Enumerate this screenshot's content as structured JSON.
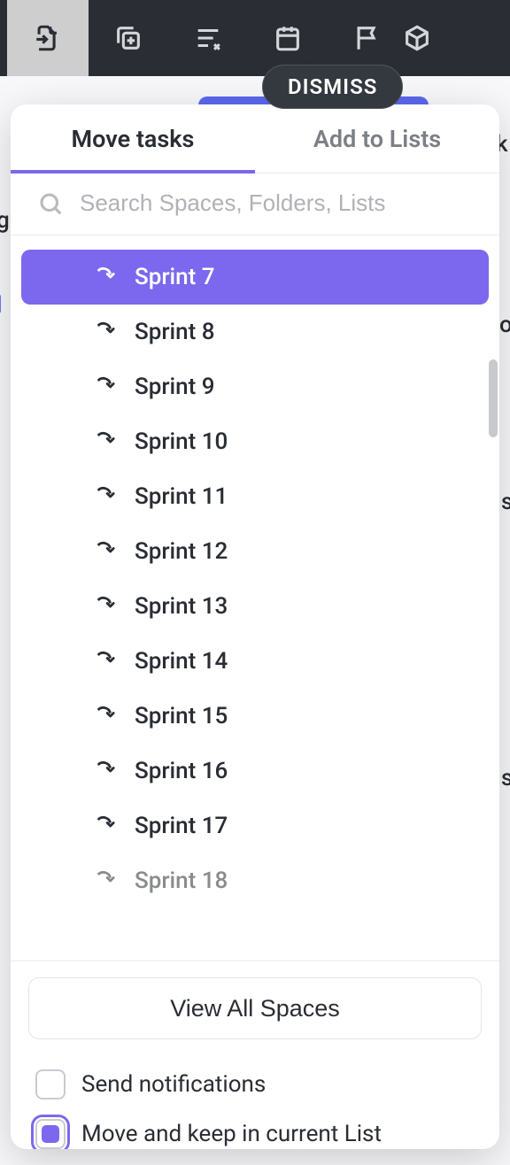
{
  "toolbar": {
    "dismiss_label": "DISMISS"
  },
  "modal": {
    "tabs": {
      "move": "Move tasks",
      "add": "Add to Lists"
    },
    "search_placeholder": "Search Spaces, Folders, Lists",
    "items": [
      {
        "label": "Sprint 7",
        "selected": true
      },
      {
        "label": "Sprint 8",
        "selected": false
      },
      {
        "label": "Sprint 9",
        "selected": false
      },
      {
        "label": "Sprint 10",
        "selected": false
      },
      {
        "label": "Sprint 11",
        "selected": false
      },
      {
        "label": "Sprint 12",
        "selected": false
      },
      {
        "label": "Sprint 13",
        "selected": false
      },
      {
        "label": "Sprint 14",
        "selected": false
      },
      {
        "label": "Sprint 15",
        "selected": false
      },
      {
        "label": "Sprint 16",
        "selected": false
      },
      {
        "label": "Sprint 17",
        "selected": false
      },
      {
        "label": "Sprint 18",
        "selected": false
      }
    ],
    "view_all_label": "View All Spaces",
    "checkbox_notify": "Send notifications",
    "checkbox_keep": "Move and keep in current List",
    "notify_checked": false,
    "keep_checked": true
  },
  "bg": {
    "frag1": "g",
    "frag2": "k",
    "frag3": "l",
    "frag4": "o",
    "frag5": "s",
    "frag6": "s"
  }
}
